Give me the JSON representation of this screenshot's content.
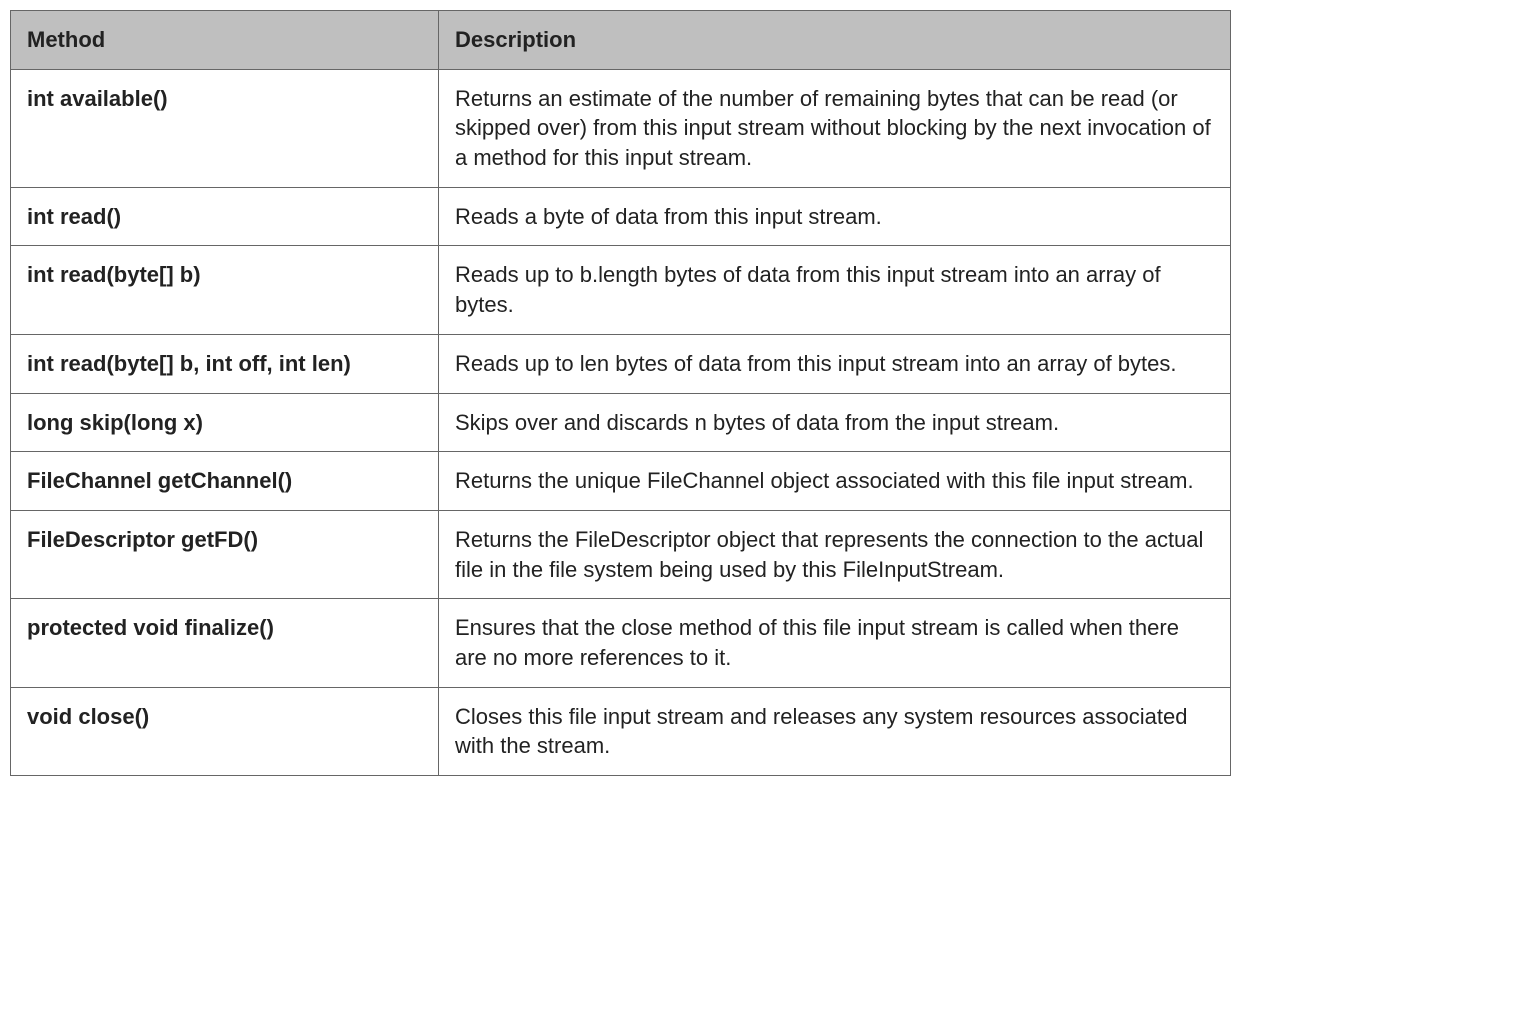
{
  "table": {
    "headers": {
      "method": "Method",
      "description": "Description"
    },
    "rows": [
      {
        "method": "int available()",
        "description": "Returns an estimate of the number of remaining bytes that can be read (or skipped over) from this input stream without blocking by the next invocation of a method for this input stream."
      },
      {
        "method": "int read()",
        "description": "Reads a byte of data from this input stream."
      },
      {
        "method": "int read(byte[] b)",
        "description": "Reads up to b.length bytes of data from this input stream into an array of bytes."
      },
      {
        "method": "int read(byte[] b, int off, int len)",
        "description": "Reads up to len bytes of data from this input stream into an array of bytes."
      },
      {
        "method": "long skip(long x)",
        "description": "Skips over and discards n bytes of data from the input stream."
      },
      {
        "method": "FileChannel getChannel()",
        "description": "Returns the unique FileChannel object associated with this file input stream."
      },
      {
        "method": "FileDescriptor getFD()",
        "description": "Returns the FileDescriptor object that represents the connection to the actual file in the file system being used by this FileInputStream."
      },
      {
        "method": "protected void finalize()",
        "description": "Ensures that the close method of this file input stream is called when there are no more references to it."
      },
      {
        "method": "void close()",
        "description": "Closes this file input stream and releases any system resources associated with the stream."
      }
    ]
  }
}
